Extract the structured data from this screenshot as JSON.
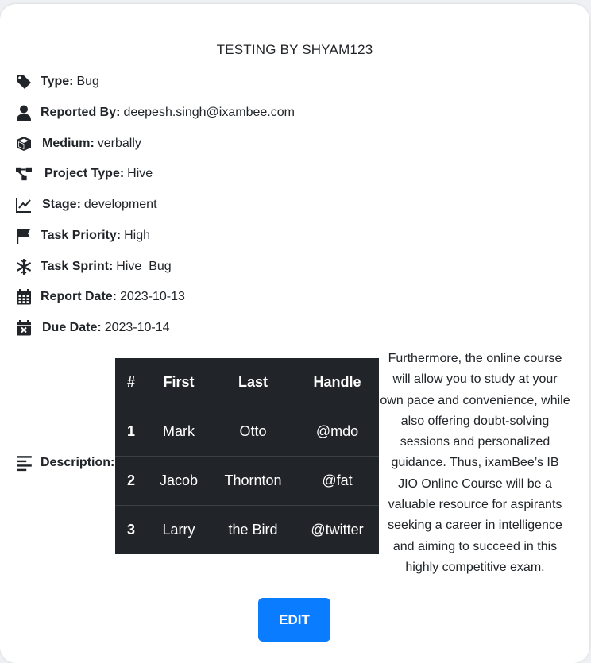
{
  "title": "TESTING BY SHYAM123",
  "fields": [
    {
      "icon": "tag-icon",
      "label": "Type:",
      "value": "Bug"
    },
    {
      "icon": "user-icon",
      "label": "Reported By:",
      "value": "deepesh.singh@ixambee.com"
    },
    {
      "icon": "cube-icon",
      "label": "Medium:",
      "value": "verbally"
    },
    {
      "icon": "sitemap-icon",
      "label": "Project Type:",
      "value": "Hive"
    },
    {
      "icon": "line-chart-icon",
      "label": "Stage:",
      "value": "development"
    },
    {
      "icon": "flag-icon",
      "label": "Task Priority:",
      "value": "High"
    },
    {
      "icon": "snowflake-icon",
      "label": "Task Sprint:",
      "value": "Hive_Bug"
    },
    {
      "icon": "calendar-icon",
      "label": "Report Date:",
      "value": "2023-10-13"
    },
    {
      "icon": "calendar-x-icon",
      "label": "Due Date:",
      "value": "2023-10-14"
    }
  ],
  "description": {
    "icon": "align-left-icon",
    "label": "Description:",
    "table": {
      "headers": [
        "#",
        "First",
        "Last",
        "Handle"
      ],
      "rows": [
        [
          "1",
          "Mark",
          "Otto",
          "@mdo"
        ],
        [
          "2",
          "Jacob",
          "Thornton",
          "@fat"
        ],
        [
          "3",
          "Larry",
          "the Bird",
          "@twitter"
        ]
      ]
    },
    "paragraph": "Furthermore, the online course will allow you to study at your own pace and convenience, while also offering doubt-solving sessions and personalized guidance. Thus, ixamBee’s IB JIO Online Course will be a valuable resource for aspirants seeking a career in intelligence and aiming to succeed in this highly competitive exam."
  },
  "edit_button": "EDIT",
  "colors": {
    "accent": "#0a7cff",
    "table_bg": "#212529",
    "text": "#212529"
  }
}
